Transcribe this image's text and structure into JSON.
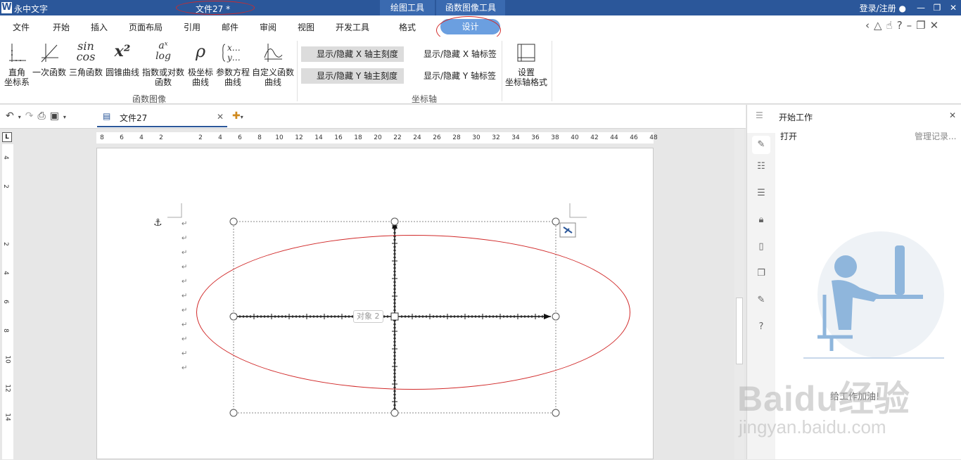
{
  "titlebar": {
    "app_name": "永中文字",
    "doc_title": "文件27 *",
    "context_tab_1": "绘图工具",
    "context_tab_2": "函数图像工具",
    "login": "登录/注册",
    "min": "—",
    "restore": "❐",
    "close": "✕"
  },
  "menu": {
    "file": "文件",
    "home": "开始",
    "insert": "插入",
    "layout": "页面布局",
    "ref": "引用",
    "mail": "邮件",
    "review": "审阅",
    "view": "视图",
    "dev": "开发工具",
    "format": "格式",
    "design": "设计"
  },
  "ribbon": {
    "rect": "直角\n坐标系",
    "linear": "一次函数",
    "trig": "三角函数",
    "conic": "圆锥曲线",
    "explog": "指数或对数\n函数",
    "polar": "极坐标\n曲线",
    "param": "参数方程\n曲线",
    "custom": "自定义函数\n曲线",
    "group1": "函数图像",
    "toggle_x_ticks": "显示/隐藏 X 轴主刻度",
    "toggle_y_ticks": "显示/隐藏 Y 轴主刻度",
    "toggle_x_label": "显示/隐藏 X 轴标签",
    "toggle_y_label": "显示/隐藏 Y 轴标签",
    "group2": "坐标轴",
    "axis_format": "设置\n坐标轴格式",
    "icon_trig": "sin\ncos",
    "icon_conic": "x²",
    "icon_exp": "aˣ\nlog",
    "icon_polar": "ρ"
  },
  "tabbar": {
    "doc_tab": "文件27"
  },
  "ruler": {
    "h_ticks": [
      "8",
      "6",
      "4",
      "2",
      "",
      "2",
      "4",
      "6",
      "8",
      "10",
      "12",
      "14",
      "16",
      "18",
      "20",
      "22",
      "24",
      "26",
      "28",
      "30",
      "32",
      "34",
      "36",
      "38",
      "40",
      "42",
      "44",
      "46",
      "48"
    ],
    "v_ticks": [
      "4",
      "2",
      "",
      "2",
      "4",
      "6",
      "8",
      "10",
      "12",
      "14"
    ]
  },
  "canvas": {
    "object_label": "对象 2"
  },
  "panel": {
    "title": "开始工作",
    "open": "打开",
    "manage": "管理记录...",
    "promo": "给工作加油!"
  },
  "watermark": {
    "brand": "Baidu经验",
    "url": "jingyan.baidu.com"
  }
}
